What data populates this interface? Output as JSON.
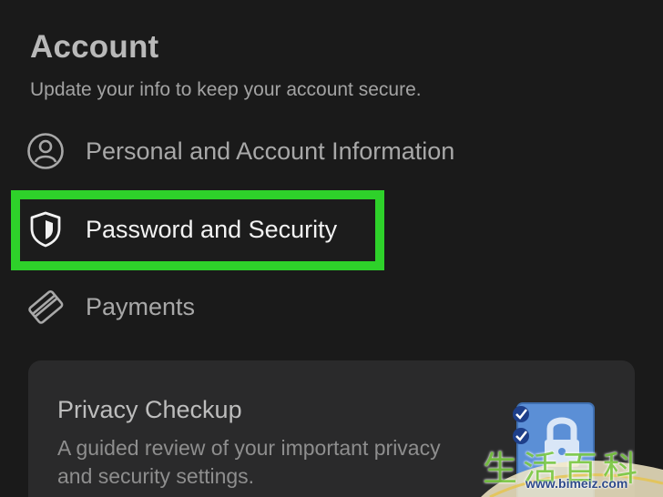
{
  "header": {
    "title": "Account",
    "subtitle": "Update your info to keep your account secure."
  },
  "menu": {
    "items": [
      {
        "label": "Personal and Account Information",
        "icon": "person-circle-icon"
      },
      {
        "label": "Password and Security",
        "icon": "shield-icon",
        "highlighted": true
      },
      {
        "label": "Payments",
        "icon": "credit-card-icon"
      }
    ]
  },
  "privacy_card": {
    "title": "Privacy Checkup",
    "description": "A guided review of your important privacy and security settings."
  },
  "watermark": {
    "chars": "生活百科",
    "url": "www.bimeiz.com"
  },
  "colors": {
    "background": "#1a1a1a",
    "highlight": "#2ed12a",
    "card": "#2a2a2b",
    "text_primary": "#f2f2f2",
    "text_muted": "#a8a8a8"
  }
}
